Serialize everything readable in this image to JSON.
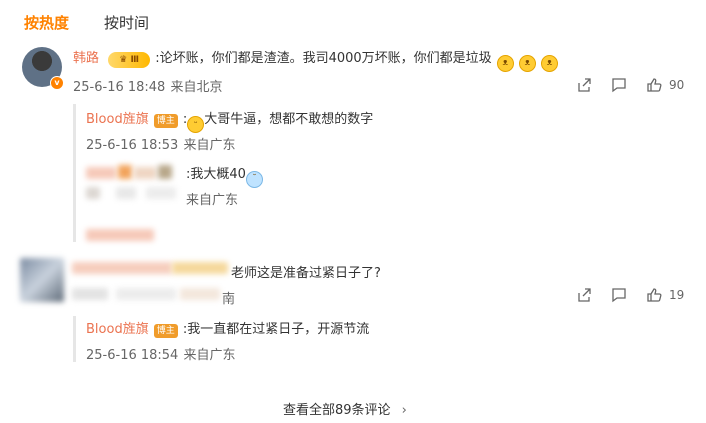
{
  "tabs": {
    "hot": "按热度",
    "time": "按时间"
  },
  "comments": [
    {
      "author": "韩路",
      "vip_level": "Ⅲ",
      "text": ":论坏账，你们都是渣渣。我司4000万坏账，你们都是垃圾",
      "emoji": [
        "cat-face",
        "cat-face",
        "cat-face"
      ],
      "time": "25-6-16 18:48",
      "location": "来自北京",
      "likes": "90",
      "replies": [
        {
          "author": "Blood旌旗",
          "badge": "博主",
          "text": "大哥牛逼，想都不敢想的数字",
          "prefix": ":",
          "time": "25-6-16 18:53",
          "location": "来自广东"
        },
        {
          "author": "",
          "badge": "",
          "text": ":我大概40",
          "time": "",
          "location": "来自广东"
        }
      ]
    },
    {
      "author": "",
      "text": "老师这是准备过紧日子了?",
      "location_partial": "南",
      "likes": "19",
      "replies": [
        {
          "author": "Blood旌旗",
          "badge": "博主",
          "text": ":我一直都在过紧日子，开源节流",
          "time": "25-6-16 18:54",
          "location": "来自广东"
        }
      ]
    }
  ],
  "footer": {
    "view_all": "查看全部89条评论",
    "chevron": "›"
  },
  "colors": {
    "accent": "#ff8200",
    "username": "#eb7350"
  },
  "icons": [
    "share-icon",
    "comment-icon",
    "like-icon"
  ]
}
